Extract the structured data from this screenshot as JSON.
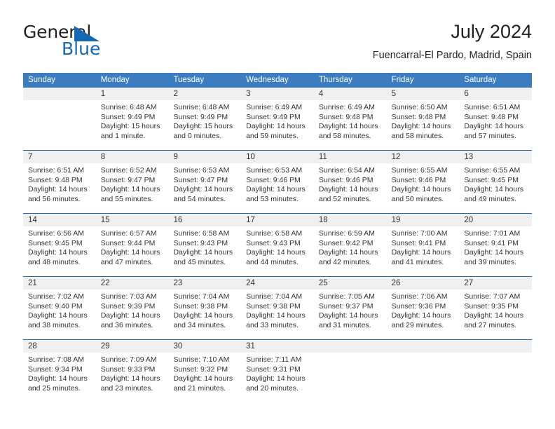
{
  "brand": {
    "name_part1": "General",
    "name_part2": "Blue",
    "triangle_color": "#1569b4"
  },
  "header": {
    "title": "July 2024",
    "subtitle": "Fuencarral-El Pardo, Madrid, Spain"
  },
  "theme": {
    "header_blue": "#3b7dc0",
    "accent_blue": "#2a6ca8",
    "daynum_band": "#f0f0f0",
    "row_divider": "#d9d9d9",
    "text": "#333333"
  },
  "weekdays": [
    "Sunday",
    "Monday",
    "Tuesday",
    "Wednesday",
    "Thursday",
    "Friday",
    "Saturday"
  ],
  "weeks": [
    {
      "accent": false,
      "days": [
        {
          "num": "",
          "sunrise": "",
          "sunset": "",
          "daylight_line1": "",
          "daylight_line2": ""
        },
        {
          "num": "1",
          "sunrise": "Sunrise: 6:48 AM",
          "sunset": "Sunset: 9:49 PM",
          "daylight_line1": "Daylight: 15 hours",
          "daylight_line2": "and 1 minute."
        },
        {
          "num": "2",
          "sunrise": "Sunrise: 6:48 AM",
          "sunset": "Sunset: 9:49 PM",
          "daylight_line1": "Daylight: 15 hours",
          "daylight_line2": "and 0 minutes."
        },
        {
          "num": "3",
          "sunrise": "Sunrise: 6:49 AM",
          "sunset": "Sunset: 9:49 PM",
          "daylight_line1": "Daylight: 14 hours",
          "daylight_line2": "and 59 minutes."
        },
        {
          "num": "4",
          "sunrise": "Sunrise: 6:49 AM",
          "sunset": "Sunset: 9:48 PM",
          "daylight_line1": "Daylight: 14 hours",
          "daylight_line2": "and 58 minutes."
        },
        {
          "num": "5",
          "sunrise": "Sunrise: 6:50 AM",
          "sunset": "Sunset: 9:48 PM",
          "daylight_line1": "Daylight: 14 hours",
          "daylight_line2": "and 58 minutes."
        },
        {
          "num": "6",
          "sunrise": "Sunrise: 6:51 AM",
          "sunset": "Sunset: 9:48 PM",
          "daylight_line1": "Daylight: 14 hours",
          "daylight_line2": "and 57 minutes."
        }
      ]
    },
    {
      "accent": true,
      "days": [
        {
          "num": "7",
          "sunrise": "Sunrise: 6:51 AM",
          "sunset": "Sunset: 9:48 PM",
          "daylight_line1": "Daylight: 14 hours",
          "daylight_line2": "and 56 minutes."
        },
        {
          "num": "8",
          "sunrise": "Sunrise: 6:52 AM",
          "sunset": "Sunset: 9:47 PM",
          "daylight_line1": "Daylight: 14 hours",
          "daylight_line2": "and 55 minutes."
        },
        {
          "num": "9",
          "sunrise": "Sunrise: 6:53 AM",
          "sunset": "Sunset: 9:47 PM",
          "daylight_line1": "Daylight: 14 hours",
          "daylight_line2": "and 54 minutes."
        },
        {
          "num": "10",
          "sunrise": "Sunrise: 6:53 AM",
          "sunset": "Sunset: 9:46 PM",
          "daylight_line1": "Daylight: 14 hours",
          "daylight_line2": "and 53 minutes."
        },
        {
          "num": "11",
          "sunrise": "Sunrise: 6:54 AM",
          "sunset": "Sunset: 9:46 PM",
          "daylight_line1": "Daylight: 14 hours",
          "daylight_line2": "and 52 minutes."
        },
        {
          "num": "12",
          "sunrise": "Sunrise: 6:55 AM",
          "sunset": "Sunset: 9:46 PM",
          "daylight_line1": "Daylight: 14 hours",
          "daylight_line2": "and 50 minutes."
        },
        {
          "num": "13",
          "sunrise": "Sunrise: 6:55 AM",
          "sunset": "Sunset: 9:45 PM",
          "daylight_line1": "Daylight: 14 hours",
          "daylight_line2": "and 49 minutes."
        }
      ]
    },
    {
      "accent": true,
      "days": [
        {
          "num": "14",
          "sunrise": "Sunrise: 6:56 AM",
          "sunset": "Sunset: 9:45 PM",
          "daylight_line1": "Daylight: 14 hours",
          "daylight_line2": "and 48 minutes."
        },
        {
          "num": "15",
          "sunrise": "Sunrise: 6:57 AM",
          "sunset": "Sunset: 9:44 PM",
          "daylight_line1": "Daylight: 14 hours",
          "daylight_line2": "and 47 minutes."
        },
        {
          "num": "16",
          "sunrise": "Sunrise: 6:58 AM",
          "sunset": "Sunset: 9:43 PM",
          "daylight_line1": "Daylight: 14 hours",
          "daylight_line2": "and 45 minutes."
        },
        {
          "num": "17",
          "sunrise": "Sunrise: 6:58 AM",
          "sunset": "Sunset: 9:43 PM",
          "daylight_line1": "Daylight: 14 hours",
          "daylight_line2": "and 44 minutes."
        },
        {
          "num": "18",
          "sunrise": "Sunrise: 6:59 AM",
          "sunset": "Sunset: 9:42 PM",
          "daylight_line1": "Daylight: 14 hours",
          "daylight_line2": "and 42 minutes."
        },
        {
          "num": "19",
          "sunrise": "Sunrise: 7:00 AM",
          "sunset": "Sunset: 9:41 PM",
          "daylight_line1": "Daylight: 14 hours",
          "daylight_line2": "and 41 minutes."
        },
        {
          "num": "20",
          "sunrise": "Sunrise: 7:01 AM",
          "sunset": "Sunset: 9:41 PM",
          "daylight_line1": "Daylight: 14 hours",
          "daylight_line2": "and 39 minutes."
        }
      ]
    },
    {
      "accent": true,
      "days": [
        {
          "num": "21",
          "sunrise": "Sunrise: 7:02 AM",
          "sunset": "Sunset: 9:40 PM",
          "daylight_line1": "Daylight: 14 hours",
          "daylight_line2": "and 38 minutes."
        },
        {
          "num": "22",
          "sunrise": "Sunrise: 7:03 AM",
          "sunset": "Sunset: 9:39 PM",
          "daylight_line1": "Daylight: 14 hours",
          "daylight_line2": "and 36 minutes."
        },
        {
          "num": "23",
          "sunrise": "Sunrise: 7:04 AM",
          "sunset": "Sunset: 9:38 PM",
          "daylight_line1": "Daylight: 14 hours",
          "daylight_line2": "and 34 minutes."
        },
        {
          "num": "24",
          "sunrise": "Sunrise: 7:04 AM",
          "sunset": "Sunset: 9:38 PM",
          "daylight_line1": "Daylight: 14 hours",
          "daylight_line2": "and 33 minutes."
        },
        {
          "num": "25",
          "sunrise": "Sunrise: 7:05 AM",
          "sunset": "Sunset: 9:37 PM",
          "daylight_line1": "Daylight: 14 hours",
          "daylight_line2": "and 31 minutes."
        },
        {
          "num": "26",
          "sunrise": "Sunrise: 7:06 AM",
          "sunset": "Sunset: 9:36 PM",
          "daylight_line1": "Daylight: 14 hours",
          "daylight_line2": "and 29 minutes."
        },
        {
          "num": "27",
          "sunrise": "Sunrise: 7:07 AM",
          "sunset": "Sunset: 9:35 PM",
          "daylight_line1": "Daylight: 14 hours",
          "daylight_line2": "and 27 minutes."
        }
      ]
    },
    {
      "accent": true,
      "days": [
        {
          "num": "28",
          "sunrise": "Sunrise: 7:08 AM",
          "sunset": "Sunset: 9:34 PM",
          "daylight_line1": "Daylight: 14 hours",
          "daylight_line2": "and 25 minutes."
        },
        {
          "num": "29",
          "sunrise": "Sunrise: 7:09 AM",
          "sunset": "Sunset: 9:33 PM",
          "daylight_line1": "Daylight: 14 hours",
          "daylight_line2": "and 23 minutes."
        },
        {
          "num": "30",
          "sunrise": "Sunrise: 7:10 AM",
          "sunset": "Sunset: 9:32 PM",
          "daylight_line1": "Daylight: 14 hours",
          "daylight_line2": "and 21 minutes."
        },
        {
          "num": "31",
          "sunrise": "Sunrise: 7:11 AM",
          "sunset": "Sunset: 9:31 PM",
          "daylight_line1": "Daylight: 14 hours",
          "daylight_line2": "and 20 minutes."
        },
        {
          "num": "",
          "sunrise": "",
          "sunset": "",
          "daylight_line1": "",
          "daylight_line2": ""
        },
        {
          "num": "",
          "sunrise": "",
          "sunset": "",
          "daylight_line1": "",
          "daylight_line2": ""
        },
        {
          "num": "",
          "sunrise": "",
          "sunset": "",
          "daylight_line1": "",
          "daylight_line2": ""
        }
      ]
    }
  ]
}
